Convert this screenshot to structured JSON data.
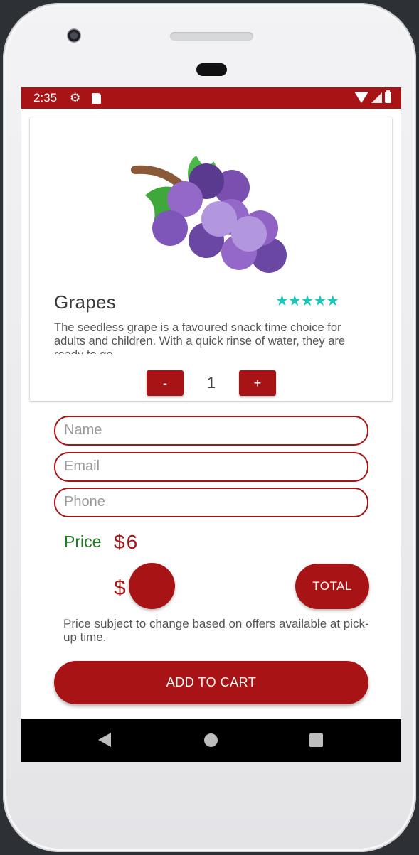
{
  "status_bar": {
    "time": "2:35",
    "icons": [
      "gear-icon",
      "sd-card-icon",
      "wifi-icon",
      "signal-icon",
      "battery-icon"
    ]
  },
  "product": {
    "name": "Grapes",
    "rating_text": "★★★★★",
    "rating": 5,
    "description": "The seedless grape is a favoured snack time choice for adults and children. With a quick rinse of water, they are ready to go.",
    "image": "grapes-illustration"
  },
  "quantity": {
    "minus_label": "-",
    "value": "1",
    "plus_label": "+"
  },
  "form": {
    "name_placeholder": "Name",
    "email_placeholder": "Email",
    "phone_placeholder": "Phone"
  },
  "price": {
    "label": "Price",
    "value": "$6"
  },
  "total": {
    "currency_symbol": "$",
    "button_label": "TOTAL"
  },
  "notice": "Price subject to change based on offers available at pick-up time.",
  "add_to_cart_label": "ADD TO CART",
  "colors": {
    "primary": "#a81416",
    "price_label": "#1f7a20",
    "rating": "#16c7b7"
  }
}
